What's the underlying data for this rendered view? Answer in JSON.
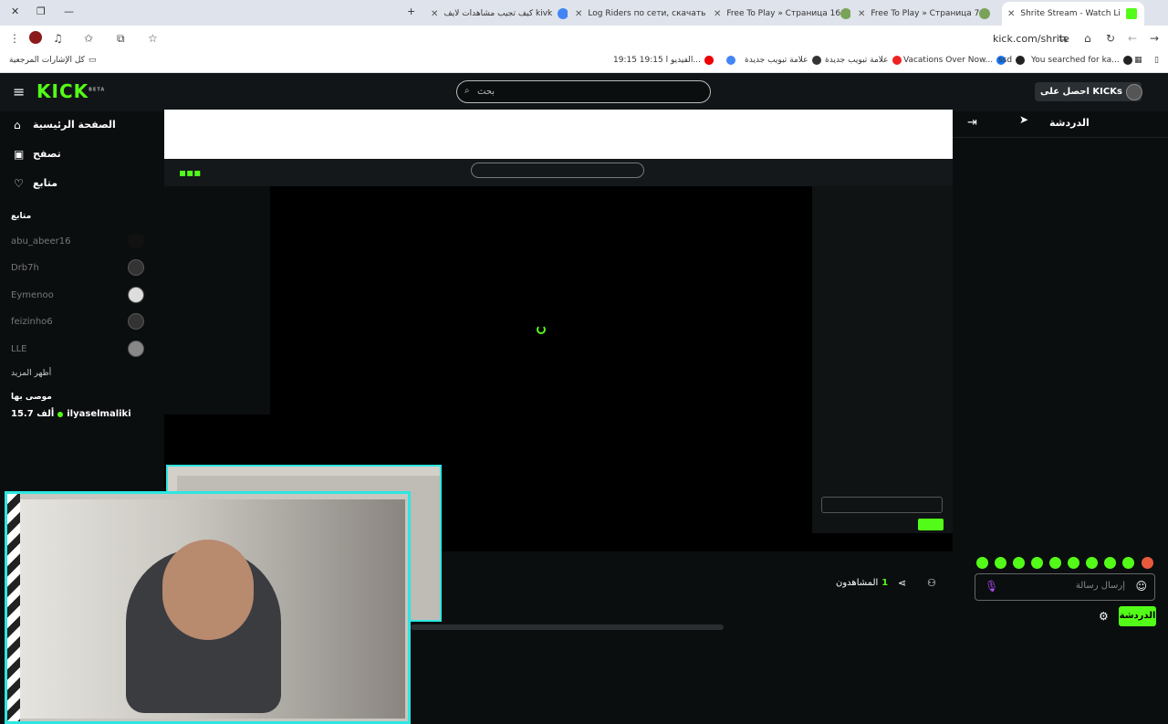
{
  "tabs": [
    {
      "title": "كيف تجيب مشاهدات لايف kivk",
      "favicon": "google-icon"
    },
    {
      "title": "Log Riders по сети, скачать игр",
      "favicon": "frog-icon"
    },
    {
      "title": "Free To Play » Страница 16",
      "favicon": "frog-icon"
    },
    {
      "title": "Free To Play » Страница 7",
      "favicon": "frog-icon"
    },
    {
      "title": "Shrite Stream - Watch Live on K",
      "favicon": "kick-icon"
    }
  ],
  "toolbar": {
    "url": "kick.com/shrite"
  },
  "bookmarks": {
    "all": "كل الإشارات المرجعية",
    "items": [
      "19:15 19:15 الفيديو ا...",
      "علامة تبويب جديدة",
      "علامة تبويب جديدة",
      "Vacations Over Now...",
      "ssd",
      "You searched for ka..."
    ]
  },
  "kick": {
    "logo": "KICK",
    "logo_tag": "BETA",
    "search_placeholder": "بحث",
    "get_kicks": "احصل على KICKs",
    "nav": {
      "home": "الصفحة الرئيسية",
      "browse": "تصفح",
      "following": "متابع"
    },
    "following_header": "متابع",
    "following": [
      "abu_abeer16",
      "Drb7h",
      "Eymenoo",
      "feizinho6",
      "LLE"
    ],
    "show_more": "أظهر المزيد",
    "recommended_header": "موصى بها",
    "recommended": {
      "name": "ilyaselmaliki",
      "viewers": "15.7 ألف"
    },
    "chat_title": "الدردشة",
    "chat_placeholder": "إرسال رسالة",
    "chat_button": "الدردشة",
    "viewers_label": "المشاهدون",
    "viewers_count": "1"
  },
  "colors": {
    "accent": "#53fc18",
    "cam_border": "#2ee6e0",
    "bg": "#0b0e0f"
  }
}
